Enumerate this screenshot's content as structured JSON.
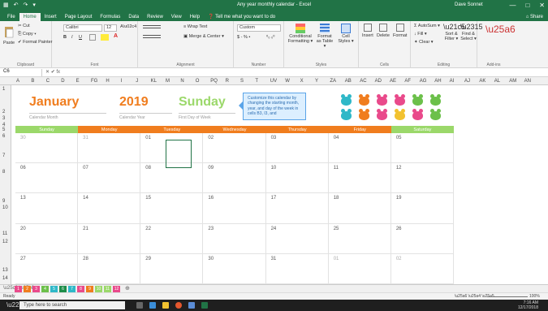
{
  "titlebar": {
    "doc": "Any year monthly calendar - Excel",
    "user": "Dave Sonnet",
    "qat": [
      "▦",
      "↶",
      "↷",
      "▾"
    ],
    "controls": [
      "—",
      "□",
      "✕"
    ]
  },
  "tabs": [
    "File",
    "Home",
    "Insert",
    "Page Layout",
    "Formulas",
    "Data",
    "Review",
    "View",
    "Help"
  ],
  "tell": "❓ Tell me what you want to do",
  "share": "⌂ Share",
  "ribbon": {
    "clipboard": {
      "paste": "Paste",
      "cut": "✂ Cut",
      "copy": "⎘ Copy ▾",
      "painter": "✔ Format Painter",
      "label": "Clipboard"
    },
    "font": {
      "name": "Calibri",
      "size": "12",
      "bold": "B",
      "italic": "I",
      "underline": "U",
      "label": "Font"
    },
    "align": {
      "wrap": "≡ Wrap Text",
      "merge": "▣ Merge & Center ▾",
      "label": "Alignment"
    },
    "number": {
      "format": "Custom",
      "currency": "$ - % •",
      "dec": "⁰₀ ₀⁰",
      "label": "Number"
    },
    "styles": {
      "cond": "Conditional Formatting ▾",
      "table": "Format as Table ▾",
      "cell": "Cell Styles ▾",
      "label": "Styles"
    },
    "cells": {
      "insert": "Insert",
      "delete": "Delete",
      "format": "Format",
      "label": "Cells"
    },
    "editing": {
      "autosum": "Σ AutoSum ▾",
      "fill": "↓ Fill ▾",
      "clear": "✦ Clear ▾",
      "sort": "Sort & Filter ▾",
      "find": "Find & Select ▾",
      "label": "Editing"
    },
    "addins": {
      "label": "Add-ins"
    }
  },
  "formula": {
    "namebox": "C6",
    "fx": "✕ ✔ fx",
    "value": ""
  },
  "columns": [
    "A",
    "B",
    "C",
    "D",
    "E",
    "FG",
    "H",
    "I",
    "J",
    "KL",
    "M",
    "N",
    "O",
    "PQ",
    "R",
    "S",
    "T",
    "UV",
    "W",
    "X",
    "Y",
    "ZA",
    "AB",
    "AC",
    "AD",
    "AE",
    "AF",
    "AG",
    "AH",
    "AI",
    "AJ",
    "AK",
    "AL",
    "AM",
    "AN"
  ],
  "rows": [
    "1",
    "2",
    "3",
    "4",
    "5",
    "6",
    "7",
    "8",
    "9",
    "10",
    "11",
    "12",
    "13",
    "14"
  ],
  "calendar": {
    "month": "January",
    "year": "2019",
    "dow": "Sunday",
    "labels": {
      "month": "Calendar Month",
      "year": "Calendar Year",
      "dow": "First Day of Week"
    },
    "tip": "Customize this calendar by changing the starting month, year, and day of the week in cells B3, I3, and",
    "days": [
      "Sunday",
      "Monday",
      "Tuesday",
      "Wednesday",
      "Thursday",
      "Friday",
      "Saturday"
    ],
    "day_colors": [
      "#9bd86a",
      "#f07d1e",
      "#f07d1e",
      "#f07d1e",
      "#f07d1e",
      "#f07d1e",
      "#9bd86a"
    ],
    "weeks": [
      [
        "30",
        "31",
        "01",
        "02",
        "03",
        "04",
        "05"
      ],
      [
        "06",
        "07",
        "08",
        "09",
        "10",
        "11",
        "12"
      ],
      [
        "13",
        "14",
        "15",
        "16",
        "17",
        "18",
        "19"
      ],
      [
        "20",
        "21",
        "22",
        "23",
        "24",
        "25",
        "26"
      ],
      [
        "27",
        "28",
        "29",
        "30",
        "31",
        "01",
        "02"
      ]
    ]
  },
  "bears": [
    "#2fb8c8",
    "#f07d1e",
    "#e94a8b",
    "#e94a8b",
    "#6cc04a",
    "#6cc04a",
    "#2fb8c8",
    "#f07d1e",
    "#e94a8b",
    "#f2c230",
    "#e94a8b",
    "#6cc04a"
  ],
  "sheettabs": {
    "items": [
      "1",
      "2",
      "3",
      "4",
      "5",
      "6",
      "7",
      "8",
      "9",
      "10",
      "11",
      "12"
    ],
    "colors": [
      "#e94a8b",
      "#f07d1e",
      "#e94a8b",
      "#6cc04a",
      "#2fb8c8",
      "#1f8e4a",
      "#2fb8c8",
      "#e94a8b",
      "#f07d1e",
      "#9bd86a",
      "#9bd86a",
      "#e94a8b"
    ],
    "add": "⊕"
  },
  "status": {
    "left": "Ready",
    "zoom": "100%"
  },
  "taskbar": {
    "search": "Type here to search",
    "time": "7:16 AM",
    "date": "12/17/2018"
  }
}
